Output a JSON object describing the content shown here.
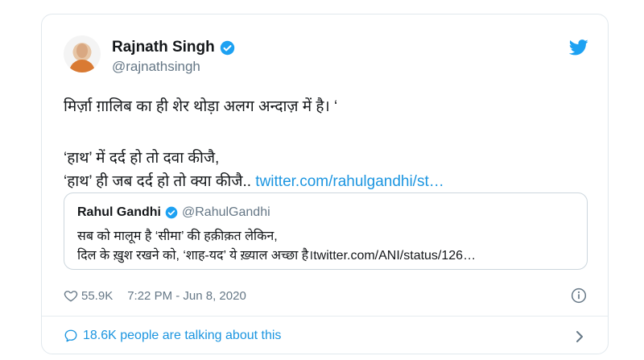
{
  "tweet": {
    "author_name": "Rajnath Singh",
    "author_handle": "@rajnathsingh",
    "text_line1": "मिर्ज़ा ग़ालिब का ही शेर थोड़ा अलग अन्दाज़ में है। ‘",
    "text_line2": "‘हाथ’ में दर्द हो तो दवा कीजै,",
    "text_line3_prefix": "‘हाथ’ ही जब दर्द हो तो क्या कीजै..",
    "text_line3_link": "twitter.com/rahulgandhi/st…",
    "likes": "55.9K",
    "timestamp": "7:22 PM - Jun 8, 2020",
    "talking_about": "18.6K people are talking about this"
  },
  "quoted_tweet": {
    "author_name": "Rahul Gandhi",
    "author_handle": "@RahulGandhi",
    "line1": "सब को मालूम है ‘सीमा’ की हक़ीक़त लेकिन,",
    "line2": "दिल के ख़ुश रखने को, ‘शाह-यद’ ये ख़्याल अच्छा है।twitter.com/ANI/status/126…"
  },
  "colors": {
    "link": "#1b95e0",
    "verified": "#1da1f2",
    "secondary_text": "#657786"
  },
  "icons": [
    "verified-badge-icon",
    "twitter-bird-icon",
    "heart-icon",
    "info-icon",
    "comment-bubble-icon",
    "chevron-right-icon"
  ]
}
